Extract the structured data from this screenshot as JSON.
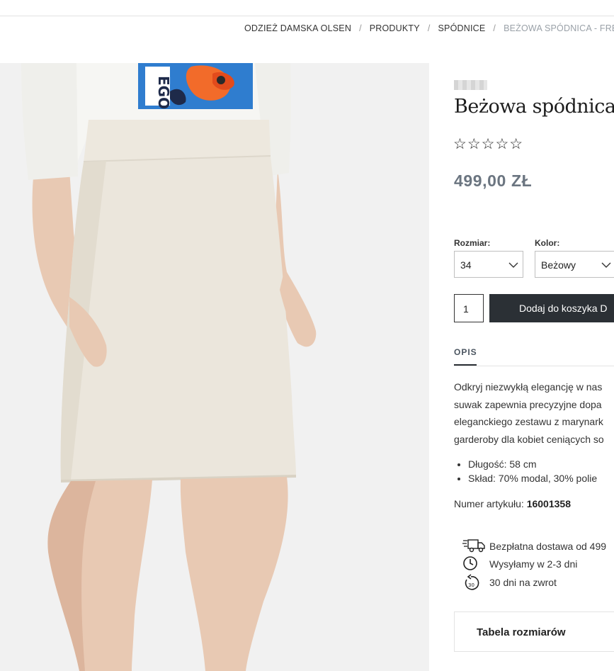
{
  "breadcrumb": {
    "items": [
      "ODZIEŻ DAMSKA OLSEN",
      "PRODUKTY",
      "SPÓDNICE"
    ],
    "current": "BEŻOWA SPÓDNICA - FRESH",
    "separator": "/"
  },
  "product": {
    "title": "Beżowa spódnica",
    "rating_stars": "☆☆☆☆☆",
    "rating_value": 0,
    "price": "499,00 ZŁ",
    "image": {
      "shirt_print_text": "UT\nEGO",
      "colors": {
        "skirt": "#ebe6dc",
        "shirt": "#f6f6f3",
        "skin": "#e8c9b3",
        "background": "#f1f1f1"
      }
    }
  },
  "options": {
    "size": {
      "label": "Rozmiar:",
      "value": "34"
    },
    "color": {
      "label": "Kolor:",
      "value": "Beżowy"
    }
  },
  "cart": {
    "quantity": "1",
    "add_label": "Dodaj do koszyka  D"
  },
  "tabs": {
    "description": "OPIS"
  },
  "description": {
    "lines": [
      "Odkryj niezwykłą elegancję w nas",
      "suwak zapewnia precyzyjne dopa",
      "eleganckiego zestawu z marynark",
      "garderoby dla kobiet ceniących so"
    ],
    "specs": [
      "Długość: 58 cm",
      "Skład: 70% modal, 30% polie"
    ],
    "article_label": "Numer artykułu:",
    "article_number": "16001358"
  },
  "features": [
    {
      "icon": "delivery-truck-icon",
      "text": "Bezpłatna dostawa od 499"
    },
    {
      "icon": "clock-icon",
      "text": "Wysyłamy w 2-3 dni"
    },
    {
      "icon": "return-icon",
      "text": "30 dni na zwrot"
    }
  ],
  "size_table": {
    "label": "Tabela rozmiarów"
  },
  "colors": {
    "accent_dark": "#2b3035",
    "price": "#6b7580",
    "breadcrumb_current": "#9aa1a8"
  }
}
